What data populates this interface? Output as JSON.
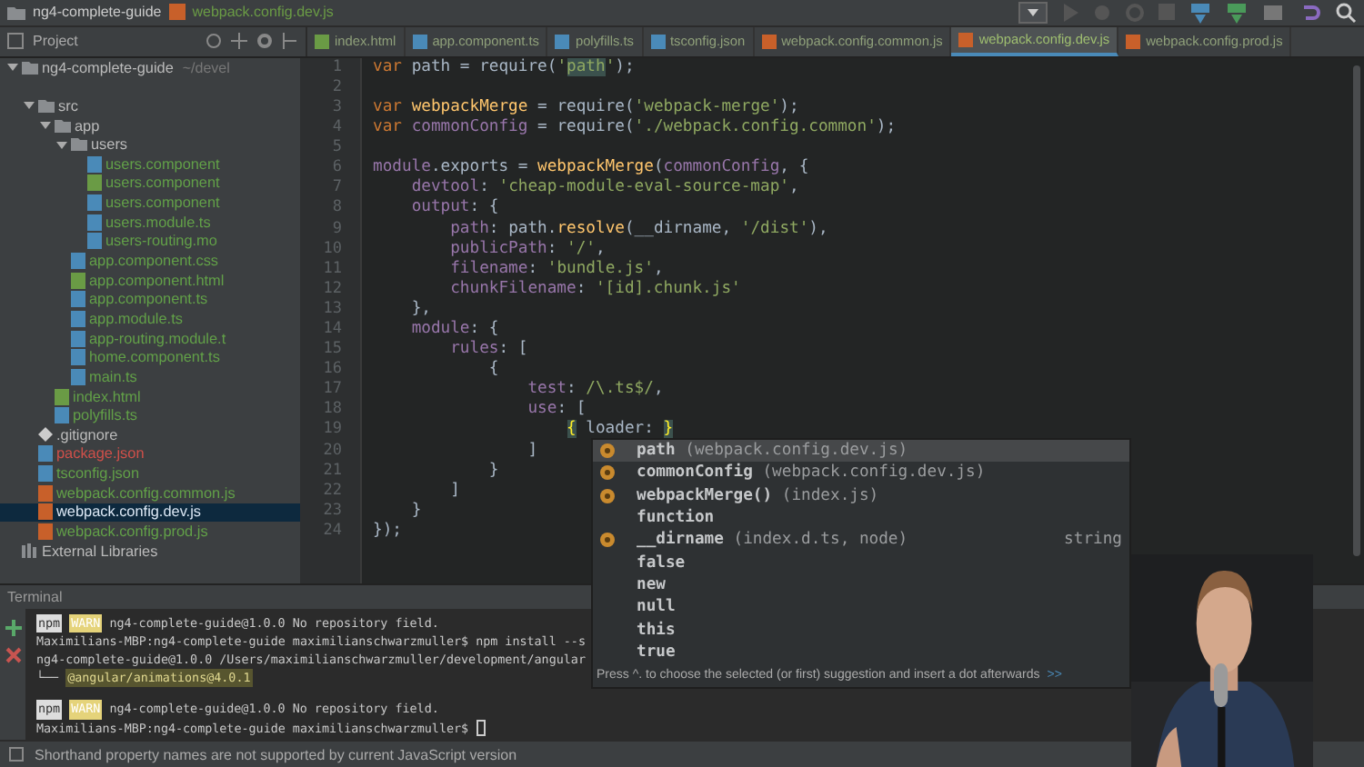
{
  "title_bar": {
    "project": "ng4-complete-guide",
    "file": "webpack.config.dev.js"
  },
  "project_panel": {
    "title": "Project"
  },
  "sidebar": {
    "tree": [
      {
        "label": "ng4-complete-guide",
        "hint": "~/devel",
        "kind": "folder",
        "expanded": true,
        "selected": false,
        "color": "#bbbbbb",
        "children": [
          {
            "label": "src",
            "kind": "folder",
            "expanded": true,
            "selected": false,
            "color": "#bbbbbb",
            "children": [
              {
                "label": "app",
                "kind": "folder",
                "expanded": true,
                "selected": false,
                "color": "#bbbbbb",
                "children": [
                  {
                    "label": "users",
                    "kind": "folder",
                    "expanded": true,
                    "selected": false,
                    "color": "#bbbbbb",
                    "children": [
                      {
                        "label": "users.component",
                        "kind": "css",
                        "selected": false,
                        "color": "#62a048"
                      },
                      {
                        "label": "users.component",
                        "kind": "html",
                        "selected": false,
                        "color": "#62a048"
                      },
                      {
                        "label": "users.component",
                        "kind": "ts",
                        "selected": false,
                        "color": "#62a048"
                      },
                      {
                        "label": "users.module.ts",
                        "kind": "ts",
                        "selected": false,
                        "color": "#62a048"
                      },
                      {
                        "label": "users-routing.mo",
                        "kind": "ts",
                        "selected": false,
                        "color": "#62a048"
                      }
                    ]
                  },
                  {
                    "label": "app.component.css",
                    "kind": "css",
                    "selected": false,
                    "color": "#62a048"
                  },
                  {
                    "label": "app.component.html",
                    "kind": "html",
                    "selected": false,
                    "color": "#62a048"
                  },
                  {
                    "label": "app.component.ts",
                    "kind": "ts",
                    "selected": false,
                    "color": "#62a048"
                  },
                  {
                    "label": "app.module.ts",
                    "kind": "ts",
                    "selected": false,
                    "color": "#62a048"
                  },
                  {
                    "label": "app-routing.module.t",
                    "kind": "ts",
                    "selected": false,
                    "color": "#62a048"
                  },
                  {
                    "label": "home.component.ts",
                    "kind": "ts",
                    "selected": false,
                    "color": "#62a048"
                  },
                  {
                    "label": "main.ts",
                    "kind": "ts",
                    "selected": false,
                    "color": "#62a048"
                  }
                ]
              },
              {
                "label": "index.html",
                "kind": "html",
                "selected": false,
                "color": "#62a048"
              },
              {
                "label": "polyfills.ts",
                "kind": "ts",
                "selected": false,
                "color": "#62a048"
              }
            ]
          },
          {
            "label": ".gitignore",
            "kind": "git",
            "selected": false,
            "color": "#bbbbbb"
          },
          {
            "label": "package.json",
            "kind": "json",
            "selected": false,
            "color": "#d0504a"
          },
          {
            "label": "tsconfig.json",
            "kind": "json",
            "selected": false,
            "color": "#62a048"
          },
          {
            "label": "webpack.config.common.js",
            "kind": "js",
            "selected": false,
            "color": "#62a048"
          },
          {
            "label": "webpack.config.dev.js",
            "kind": "js",
            "selected": true
          },
          {
            "label": "webpack.config.prod.js",
            "kind": "js",
            "selected": false,
            "color": "#62a048"
          }
        ]
      },
      {
        "label": "External Libraries",
        "kind": "lib",
        "selected": false,
        "color": "#bbbbbb"
      }
    ]
  },
  "editor_tabs": [
    {
      "label": "index.html",
      "kind": "html",
      "selected": false
    },
    {
      "label": "app.component.ts",
      "kind": "ts",
      "selected": false
    },
    {
      "label": "polyfills.ts",
      "kind": "ts",
      "selected": false
    },
    {
      "label": "tsconfig.json",
      "kind": "json",
      "selected": false
    },
    {
      "label": "webpack.config.common.js",
      "kind": "js",
      "selected": false
    },
    {
      "label": "webpack.config.dev.js",
      "kind": "js",
      "selected": true
    },
    {
      "label": "webpack.config.prod.js",
      "kind": "js",
      "selected": false
    }
  ],
  "editor": {
    "lines": [
      {
        "number": "1",
        "tokens": [
          {
            "kind": "keyword",
            "text": "var"
          },
          {
            "kind": "plain",
            "text": " path = require("
          },
          {
            "kind": "string",
            "text": "'"
          },
          {
            "kind": "match",
            "text": "path"
          },
          {
            "kind": "string",
            "text": "'"
          },
          {
            "kind": "plain",
            "text": ");"
          }
        ]
      },
      {
        "number": "2"
      },
      {
        "number": "3",
        "tokens": [
          {
            "kind": "keyword",
            "text": "var"
          },
          {
            "kind": "function",
            "text": " webpackMerge"
          },
          {
            "kind": "plain",
            "text": " = require("
          },
          {
            "kind": "string",
            "text": "'webpack-merge'"
          },
          {
            "kind": "plain",
            "text": ");"
          }
        ]
      },
      {
        "number": "4",
        "tokens": [
          {
            "kind": "keyword",
            "text": "var"
          },
          {
            "kind": "property",
            "text": " commonConfig"
          },
          {
            "kind": "plain",
            "text": " = require("
          },
          {
            "kind": "string",
            "text": "'./webpack.config.common'"
          },
          {
            "kind": "plain",
            "text": ");"
          }
        ]
      },
      {
        "number": "5"
      },
      {
        "number": "6",
        "tokens": [
          {
            "kind": "property",
            "text": "module"
          },
          {
            "kind": "plain",
            "text": ".exports = "
          },
          {
            "kind": "function",
            "text": "webpackMerge"
          },
          {
            "kind": "plain",
            "text": "("
          },
          {
            "kind": "property",
            "text": "commonConfig"
          },
          {
            "kind": "plain",
            "text": ", {"
          }
        ]
      },
      {
        "number": "7",
        "tokens": [
          {
            "kind": "property",
            "text": "    devtool"
          },
          {
            "kind": "plain",
            "text": ": "
          },
          {
            "kind": "string",
            "text": "'cheap-module-eval-source-map'"
          },
          {
            "kind": "plain",
            "text": ","
          }
        ]
      },
      {
        "number": "8",
        "tokens": [
          {
            "kind": "property",
            "text": "    output"
          },
          {
            "kind": "plain",
            "text": ": {"
          }
        ]
      },
      {
        "number": "9",
        "tokens": [
          {
            "kind": "property",
            "text": "        path"
          },
          {
            "kind": "plain",
            "text": ": path."
          },
          {
            "kind": "function",
            "text": "resolve"
          },
          {
            "kind": "plain",
            "text": "(__dirname, "
          },
          {
            "kind": "string",
            "text": "'/dist'"
          },
          {
            "kind": "plain",
            "text": "),"
          }
        ]
      },
      {
        "number": "10",
        "tokens": [
          {
            "kind": "property",
            "text": "        publicPath"
          },
          {
            "kind": "plain",
            "text": ": "
          },
          {
            "kind": "string",
            "text": "'/'"
          },
          {
            "kind": "plain",
            "text": ","
          }
        ]
      },
      {
        "number": "11",
        "tokens": [
          {
            "kind": "property",
            "text": "        filename"
          },
          {
            "kind": "plain",
            "text": ": "
          },
          {
            "kind": "string",
            "text": "'bundle.js'"
          },
          {
            "kind": "plain",
            "text": ","
          }
        ]
      },
      {
        "number": "12",
        "tokens": [
          {
            "kind": "property",
            "text": "        chunkFilename"
          },
          {
            "kind": "plain",
            "text": ": "
          },
          {
            "kind": "string",
            "text": "'[id].chunk.js'"
          }
        ]
      },
      {
        "number": "13",
        "tokens": [
          {
            "kind": "plain",
            "text": "    },"
          }
        ]
      },
      {
        "number": "14",
        "tokens": [
          {
            "kind": "property",
            "text": "    module"
          },
          {
            "kind": "plain",
            "text": ": {"
          }
        ]
      },
      {
        "number": "15",
        "tokens": [
          {
            "kind": "property",
            "text": "        rules"
          },
          {
            "kind": "plain",
            "text": ": ["
          }
        ]
      },
      {
        "number": "16",
        "tokens": [
          {
            "kind": "plain",
            "text": "            {"
          }
        ]
      },
      {
        "number": "17",
        "tokens": [
          {
            "kind": "property",
            "text": "                test"
          },
          {
            "kind": "plain",
            "text": ": "
          },
          {
            "kind": "string",
            "text": "/\\.ts$/"
          },
          {
            "kind": "plain",
            "text": ","
          }
        ]
      },
      {
        "number": "18",
        "tokens": [
          {
            "kind": "property",
            "text": "                use"
          },
          {
            "kind": "plain",
            "text": ": ["
          }
        ]
      },
      {
        "number": "19",
        "tokens": [
          {
            "kind": "brace",
            "text": "                    {"
          },
          {
            "kind": "plain",
            "text": " loader: "
          },
          {
            "kind": "brace",
            "text": "}"
          }
        ]
      },
      {
        "number": "20",
        "tokens": [
          {
            "kind": "plain",
            "text": "                ]"
          }
        ]
      },
      {
        "number": "21",
        "tokens": [
          {
            "kind": "plain",
            "text": "            }"
          }
        ]
      },
      {
        "number": "22",
        "tokens": [
          {
            "kind": "plain",
            "text": "        ]"
          }
        ]
      },
      {
        "number": "23",
        "tokens": [
          {
            "kind": "plain",
            "text": "    }"
          }
        ]
      },
      {
        "number": "24",
        "tokens": [
          {
            "kind": "plain",
            "text": "});"
          }
        ]
      }
    ]
  },
  "completion": {
    "items": [
      {
        "kind": "variable",
        "label": "path",
        "detail": "(webpack.config.dev.js)",
        "selected": true
      },
      {
        "kind": "variable",
        "label": "commonConfig",
        "detail": "(webpack.config.dev.js)",
        "selected": false
      },
      {
        "kind": "variable",
        "label": "webpackMerge()",
        "detail": "(index.js)",
        "selected": false
      },
      {
        "kind": "keyword",
        "label": "function",
        "selected": false
      },
      {
        "kind": "variable",
        "label": "__dirname",
        "detail": "(index.d.ts, node)",
        "type": "string",
        "selected": false
      },
      {
        "kind": "keyword",
        "label": "false",
        "selected": false
      },
      {
        "kind": "keyword",
        "label": "new",
        "selected": false
      },
      {
        "kind": "keyword",
        "label": "null",
        "selected": false
      },
      {
        "kind": "keyword",
        "label": "this",
        "selected": false
      },
      {
        "kind": "keyword",
        "label": "true",
        "selected": false
      }
    ],
    "hint": "Press ^. to choose the selected (or first) suggestion and insert a dot afterwards",
    "hint_link": ">>"
  },
  "terminal": {
    "title": "Terminal",
    "lines": [
      {
        "kind": "warn",
        "badge": "npm",
        "level": "WARN",
        "text": "ng4-complete-guide@1.0.0 No repository field."
      },
      {
        "kind": "plain",
        "text": "Maximilians-MBP:ng4-complete-guide maximilianschwarzmuller$ npm install --s"
      },
      {
        "kind": "plain",
        "text": "ng4-complete-guide@1.0.0 /Users/maximilianschwarzmuller/development/angular"
      },
      {
        "kind": "tree",
        "prefix": "└──",
        "text": "@angular/animations@4.0.1"
      },
      {
        "kind": "blank"
      },
      {
        "kind": "warn",
        "badge": "npm",
        "level": "WARN",
        "text": "ng4-complete-guide@1.0.0 No repository field."
      },
      {
        "kind": "prompt",
        "text": "Maximilians-MBP:ng4-complete-guide maximilianschwarzmuller$"
      }
    ]
  },
  "status_bar": {
    "message": "Shorthand property names are not supported by current JavaScript version"
  }
}
